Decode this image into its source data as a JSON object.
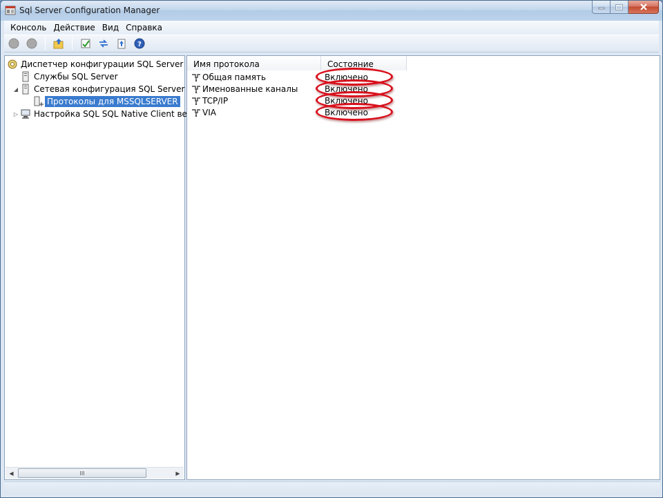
{
  "window": {
    "title": "Sql Server Configuration Manager"
  },
  "menu": [
    "Консоль",
    "Действие",
    "Вид",
    "Справка"
  ],
  "toolbar": {
    "buttons": [
      "back-icon",
      "forward-icon",
      "up-folder-icon",
      "properties-icon",
      "refresh-icon",
      "export-icon",
      "help-icon"
    ]
  },
  "tree": {
    "items": [
      {
        "label": "Диспетчер конфигурации SQL Server (Лока",
        "icon": "config-manager-icon",
        "expander": ""
      },
      {
        "label": "Службы SQL Server",
        "icon": "server-icon",
        "expander": ""
      },
      {
        "label": "Сетевая конфигурация SQL Server",
        "icon": "server-icon",
        "expander": "◢"
      },
      {
        "label": "Протоколы для MSSQLSERVER",
        "icon": "protocols-icon",
        "expander": ""
      },
      {
        "label": "Настройка SQL SQL Native Client верси",
        "icon": "client-icon",
        "expander": "▷"
      }
    ],
    "scroll_grip": "III"
  },
  "list": {
    "columns": [
      "Имя протокола",
      "Состояние"
    ],
    "rows": [
      {
        "name": "Общая память",
        "state": "Включено"
      },
      {
        "name": "Именованные каналы",
        "state": "Включено"
      },
      {
        "name": "TCP/IP",
        "state": "Включено"
      },
      {
        "name": "VIA",
        "state": "Включено"
      }
    ]
  },
  "colors": {
    "selection": "#3a7bcf",
    "annotation_ring": "#d8101c"
  }
}
